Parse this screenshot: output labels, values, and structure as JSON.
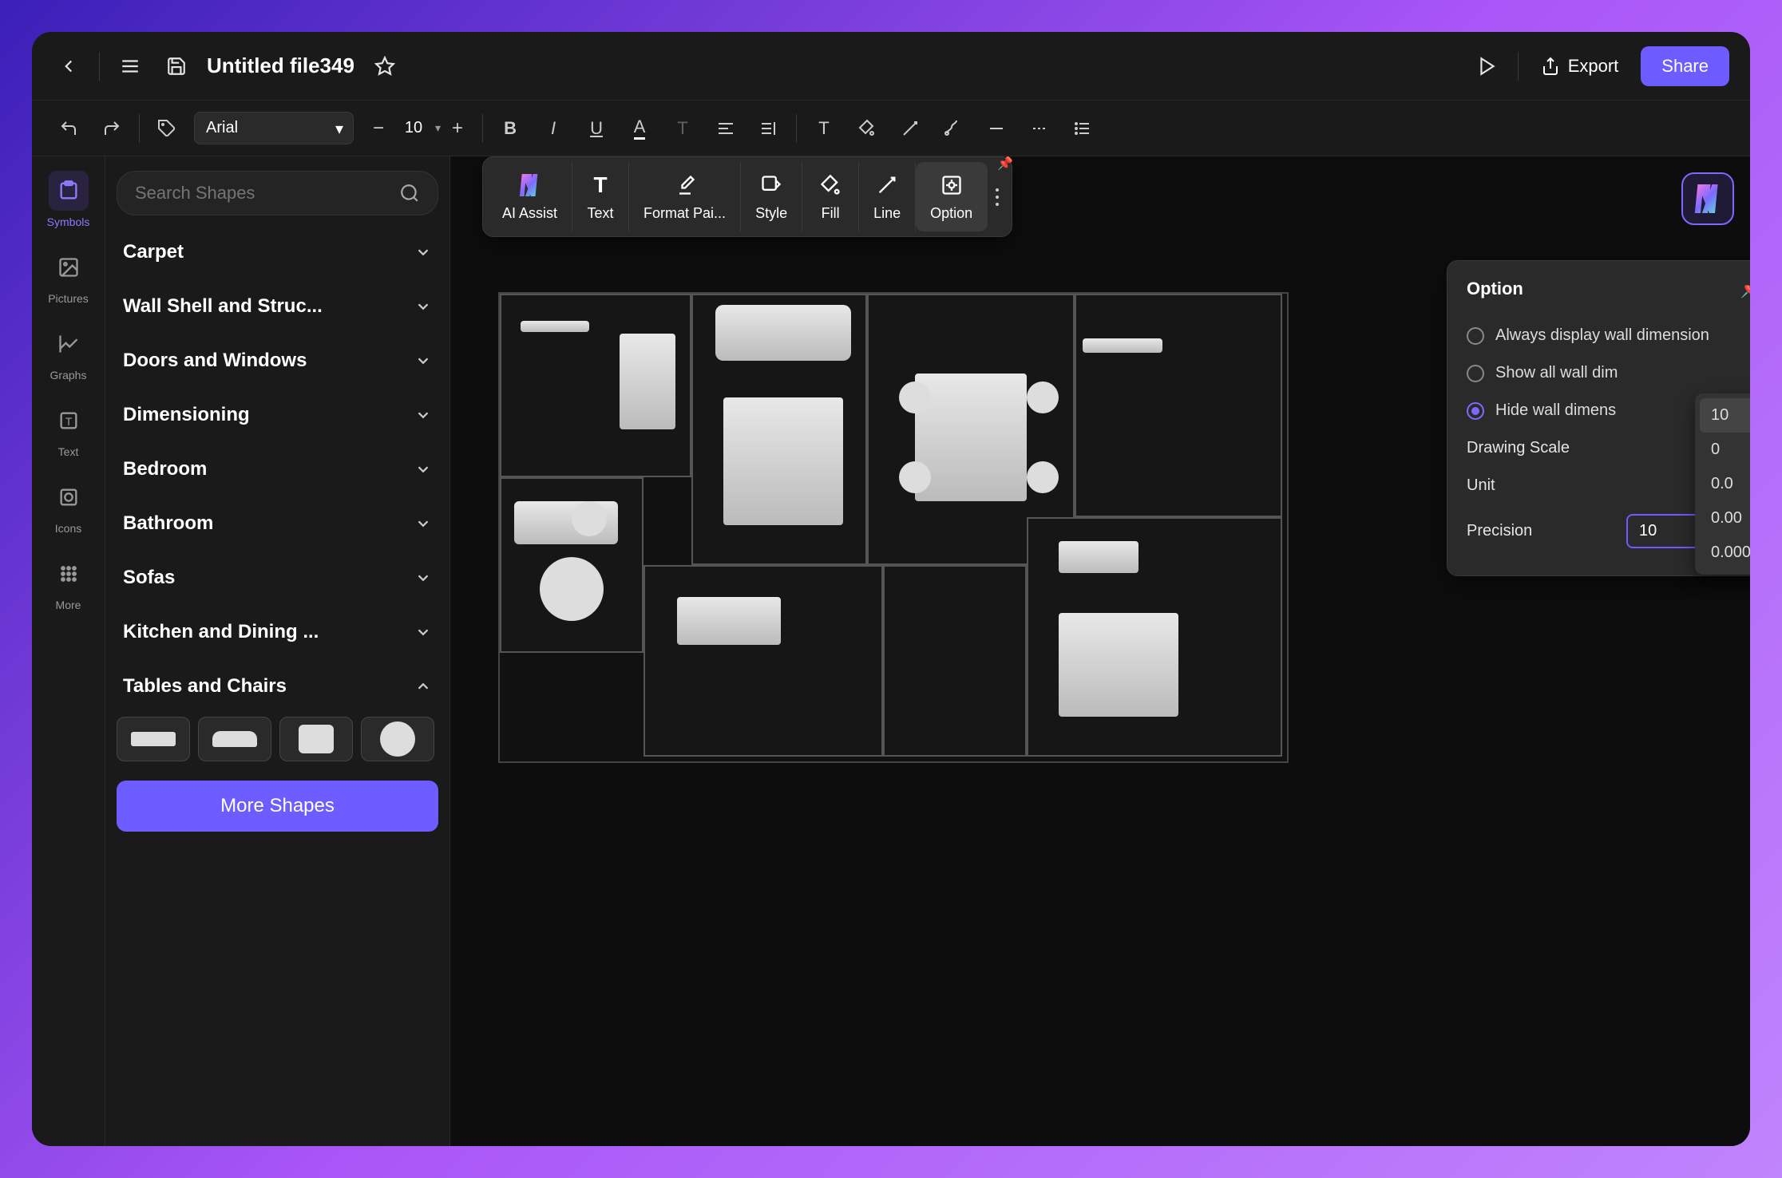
{
  "header": {
    "file_title": "Untitled file349",
    "export_label": "Export",
    "share_label": "Share"
  },
  "toolbar": {
    "font_family": "Arial",
    "font_size": "10"
  },
  "rail": {
    "items": [
      {
        "id": "symbols",
        "label": "Symbols"
      },
      {
        "id": "pictures",
        "label": "Pictures"
      },
      {
        "id": "graphs",
        "label": "Graphs"
      },
      {
        "id": "text",
        "label": "Text"
      },
      {
        "id": "icons",
        "label": "Icons"
      },
      {
        "id": "more",
        "label": "More"
      }
    ]
  },
  "sidebar": {
    "search_placeholder": "Search Shapes",
    "categories": [
      "Carpet",
      "Wall Shell and Struc...",
      "Doors and Windows",
      "Dimensioning",
      "Bedroom",
      "Bathroom",
      "Sofas",
      "Kitchen and Dining ...",
      "Tables and Chairs"
    ],
    "more_shapes_label": "More Shapes"
  },
  "float_toolbar": {
    "items": [
      "AI Assist",
      "Text",
      "Format Pai...",
      "Style",
      "Fill",
      "Line",
      "Option"
    ]
  },
  "option_panel": {
    "title": "Option",
    "radios": [
      {
        "label": "Always display wall dimension",
        "checked": false
      },
      {
        "label": "Show all wall dim",
        "checked": false
      },
      {
        "label": "Hide wall dimens",
        "checked": true
      }
    ],
    "fields": {
      "drawing_scale": "Drawing Scale",
      "unit": "Unit",
      "precision": "Precision"
    },
    "precision_value": "10",
    "precision_options": [
      "10",
      "0",
      "0.0",
      "0.00",
      "0.000"
    ]
  }
}
